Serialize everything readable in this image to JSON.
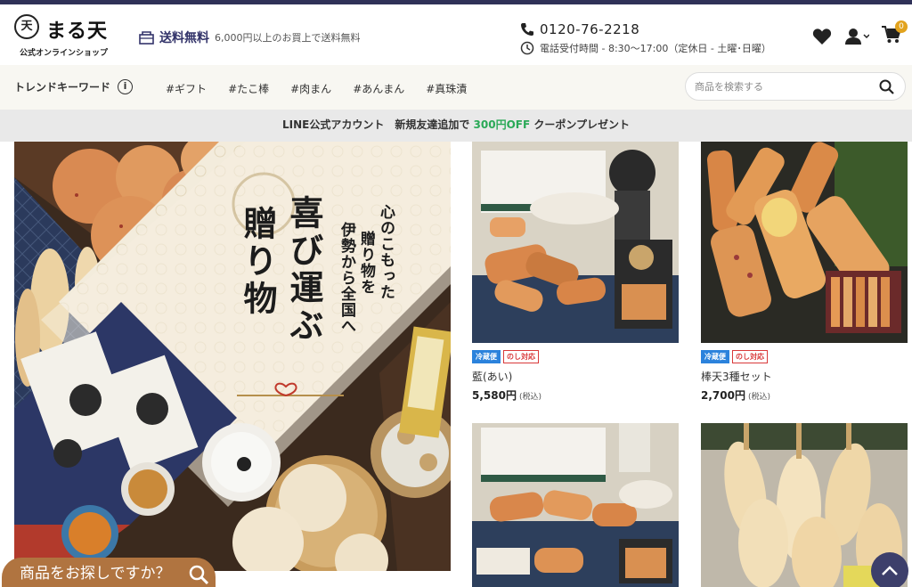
{
  "brand": {
    "mark": "天",
    "name": "まる天",
    "subtitle": "公式オンラインショップ"
  },
  "header": {
    "shipping_title": "送料無料",
    "shipping_note": "6,000円以上のお買上で送料無料",
    "phone": "0120-76-2218",
    "hours": "電話受付時間 - 8:30～17:00（定休日 - 土曜･日曜）",
    "cart_count": "0",
    "icons": [
      "heart-icon",
      "user-icon",
      "cart-icon"
    ]
  },
  "nav": {
    "trend_label": "トレンドキーワード",
    "tags": [
      "#ギフト",
      "#たこ棒",
      "#肉まん",
      "#あんまん",
      "#真珠漬"
    ],
    "search_placeholder": "商品を検索する"
  },
  "line_banner": {
    "prefix": "LINE公式アカウント　新規友達追加で ",
    "highlight": "300円OFF",
    "suffix": " クーポンプレゼント"
  },
  "hero": {
    "title_col1": "喜び運ぶ",
    "title_col2": "贈り物",
    "sub_col1": "心のこもった",
    "sub_col2": "贈り物を",
    "sub_col3": "伊勢から全国へ"
  },
  "products": [
    {
      "badge_cold": "冷蔵便",
      "badge_noshi": "のし対応",
      "name": "藍(あい)",
      "price": "5,580円",
      "tax": "(税込)"
    },
    {
      "badge_cold": "冷蔵便",
      "badge_noshi": "のし対応",
      "name": "棒天3種セット",
      "price": "2,700円",
      "tax": "(税込)"
    }
  ],
  "float_search": {
    "label": "商品をお探しですか？"
  },
  "colors": {
    "navy": "#2f3158",
    "line_green": "#2aa957",
    "cold_blue": "#2b82dc",
    "noshi_red": "#d9393a",
    "float_brown": "#b07440",
    "badge_orange": "#e2a31e"
  }
}
